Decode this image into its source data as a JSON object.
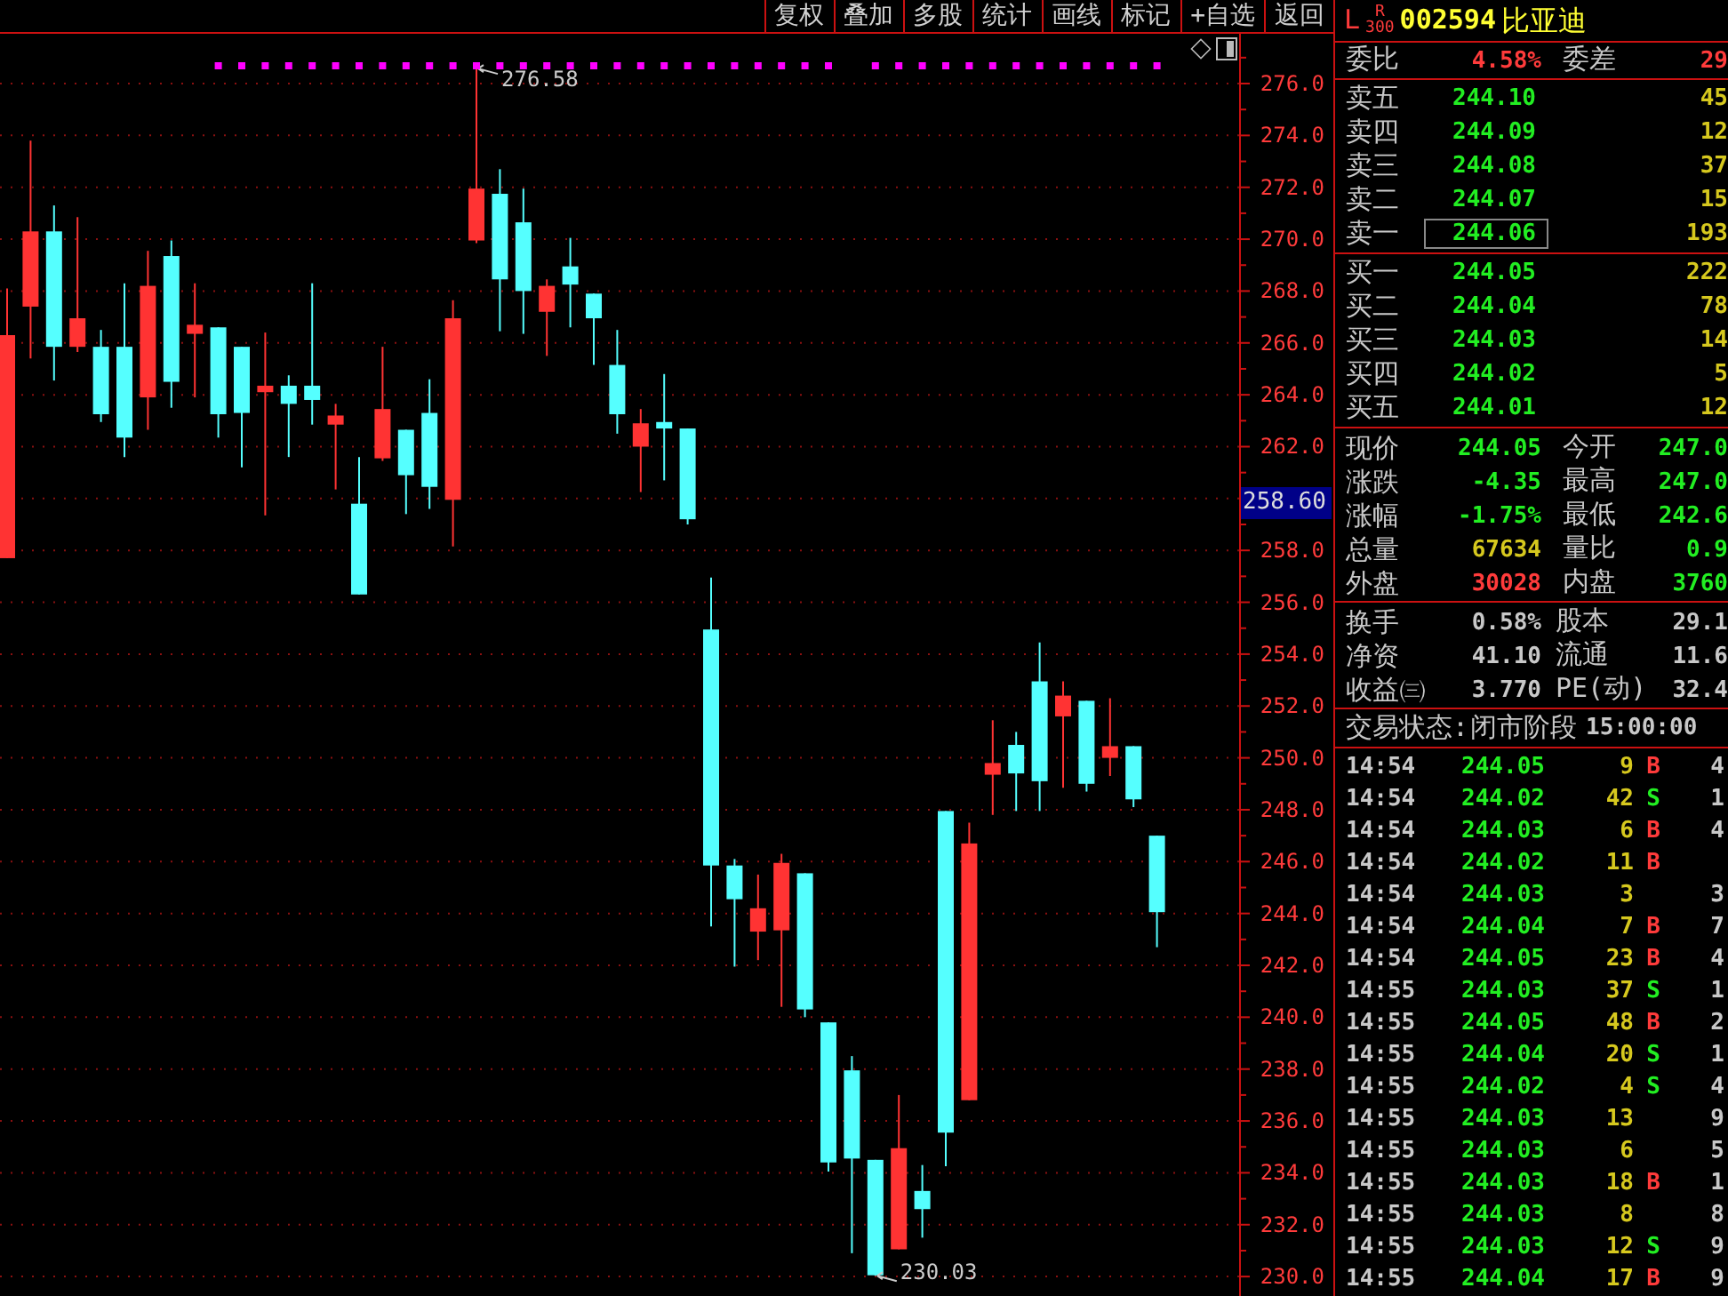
{
  "toolbar": [
    "复权",
    "叠加",
    "多股",
    "统计",
    "画线",
    "标记",
    "+自选",
    "返回"
  ],
  "chart": {
    "cursor_price": "258.60",
    "chart_data": {
      "type": "candlestick",
      "ylim": [
        229.25,
        277.92
      ],
      "grid": true,
      "yticks": [
        {
          "value": 276,
          "label": "276.0"
        },
        {
          "value": 274,
          "label": "274.0"
        },
        {
          "value": 272,
          "label": "272.0"
        },
        {
          "value": 270,
          "label": "270.0"
        },
        {
          "value": 268,
          "label": "268.0"
        },
        {
          "value": 266,
          "label": "266.0"
        },
        {
          "value": 264,
          "label": "264.0"
        },
        {
          "value": 262,
          "label": "262.0"
        },
        {
          "value": 258,
          "label": "258.0"
        },
        {
          "value": 256,
          "label": "256.0"
        },
        {
          "value": 254,
          "label": "254.0"
        },
        {
          "value": 252,
          "label": "252.0"
        },
        {
          "value": 250,
          "label": "250.0"
        },
        {
          "value": 248,
          "label": "248.0"
        },
        {
          "value": 246,
          "label": "246.0"
        },
        {
          "value": 244,
          "label": "244.0"
        },
        {
          "value": 242,
          "label": "242.0"
        },
        {
          "value": 240,
          "label": "240.0"
        },
        {
          "value": 238,
          "label": "238.0"
        },
        {
          "value": 236,
          "label": "236.0"
        },
        {
          "value": 234,
          "label": "234.0"
        },
        {
          "value": 232,
          "label": "232.0"
        },
        {
          "value": 230,
          "label": "230.0"
        }
      ],
      "ohlc": [
        [
          257.7,
          268.1,
          257.7,
          266.3
        ],
        [
          267.4,
          273.8,
          265.4,
          270.3
        ],
        [
          270.3,
          271.3,
          264.55,
          265.85
        ],
        [
          265.85,
          270.85,
          265.65,
          266.95
        ],
        [
          265.85,
          266.5,
          262.95,
          263.25
        ],
        [
          265.85,
          268.3,
          261.6,
          262.35
        ],
        [
          263.9,
          269.55,
          262.65,
          268.2
        ],
        [
          269.35,
          269.95,
          263.5,
          264.5
        ],
        [
          266.35,
          268.3,
          263.9,
          266.7
        ],
        [
          266.6,
          266.6,
          262.35,
          263.25
        ],
        [
          265.85,
          265.85,
          261.2,
          263.3
        ],
        [
          264.1,
          266.4,
          259.35,
          264.35
        ],
        [
          264.35,
          264.75,
          261.6,
          263.65
        ],
        [
          264.35,
          268.3,
          262.85,
          263.8
        ],
        [
          262.85,
          263.65,
          260.35,
          263.2
        ],
        [
          259.8,
          261.6,
          256.3,
          256.3
        ],
        [
          261.55,
          265.85,
          261.45,
          263.45
        ],
        [
          262.65,
          262.65,
          259.4,
          260.9
        ],
        [
          263.3,
          264.6,
          259.6,
          260.45
        ],
        [
          259.95,
          267.65,
          258.15,
          266.95
        ],
        [
          269.95,
          276.58,
          269.85,
          271.95
        ],
        [
          271.75,
          272.7,
          266.45,
          268.45
        ],
        [
          270.65,
          271.95,
          266.35,
          268.0
        ],
        [
          267.2,
          268.45,
          265.5,
          268.2
        ],
        [
          268.95,
          270.05,
          266.6,
          268.25
        ],
        [
          267.9,
          267.9,
          265.15,
          266.95
        ],
        [
          265.15,
          266.5,
          262.5,
          263.25
        ],
        [
          262.0,
          263.45,
          260.25,
          262.9
        ],
        [
          262.95,
          264.8,
          260.7,
          262.7
        ],
        [
          262.7,
          262.7,
          259.0,
          259.2
        ],
        [
          254.95,
          256.95,
          243.5,
          245.85
        ],
        [
          245.85,
          246.1,
          241.95,
          244.55
        ],
        [
          243.3,
          245.5,
          242.2,
          244.2
        ],
        [
          243.35,
          246.3,
          240.4,
          245.95
        ],
        [
          245.55,
          245.55,
          240.0,
          240.3
        ],
        [
          239.8,
          239.8,
          234.05,
          234.4
        ],
        [
          237.95,
          238.5,
          230.9,
          234.55
        ],
        [
          234.5,
          234.5,
          230.03,
          230.05
        ],
        [
          231.05,
          237.0,
          231.05,
          234.95
        ],
        [
          233.3,
          234.3,
          231.5,
          232.6
        ],
        [
          247.95,
          247.95,
          234.25,
          235.55
        ],
        [
          236.8,
          247.5,
          236.8,
          246.7
        ],
        [
          249.35,
          251.45,
          247.8,
          249.8
        ],
        [
          250.5,
          251.0,
          247.95,
          249.4
        ],
        [
          252.95,
          254.45,
          247.95,
          249.1
        ],
        [
          251.6,
          252.95,
          248.85,
          252.4
        ],
        [
          252.2,
          252.2,
          248.7,
          249.0
        ],
        [
          250.0,
          252.3,
          249.3,
          250.45
        ],
        [
          250.45,
          250.45,
          248.1,
          248.4
        ],
        [
          247.0,
          247.0,
          242.7,
          244.05
        ]
      ],
      "annotations": [
        {
          "text": "276.58"
        },
        {
          "text": "230.03"
        }
      ]
    }
  },
  "stock": {
    "market": "L",
    "index_mark": "R",
    "index_code": "300",
    "code": "002594",
    "name": "比亚迪"
  },
  "order_summary": [
    {
      "label": "委比",
      "value": "4.58%"
    },
    {
      "label": "委差",
      "value": "29"
    }
  ],
  "asks": [
    {
      "label": "卖五",
      "price": "244.10",
      "volume": "45",
      "selected": false
    },
    {
      "label": "卖四",
      "price": "244.09",
      "volume": "12",
      "selected": false
    },
    {
      "label": "卖三",
      "price": "244.08",
      "volume": "37",
      "selected": false
    },
    {
      "label": "卖二",
      "price": "244.07",
      "volume": "15",
      "selected": false
    },
    {
      "label": "卖一",
      "price": "244.06",
      "volume": "193",
      "selected": true
    }
  ],
  "bids": [
    {
      "label": "买一",
      "price": "244.05",
      "volume": "222",
      "selected": false
    },
    {
      "label": "买二",
      "price": "244.04",
      "volume": "78",
      "selected": false
    },
    {
      "label": "买三",
      "price": "244.03",
      "volume": "14",
      "selected": false
    },
    {
      "label": "买四",
      "price": "244.02",
      "volume": "5",
      "selected": false
    },
    {
      "label": "买五",
      "price": "244.01",
      "volume": "12",
      "selected": false
    }
  ],
  "quote": [
    {
      "label": "现价",
      "value": "244.05",
      "color": "#22ee22",
      "label2": "今开",
      "value2": "247.0"
    },
    {
      "label": "涨跌",
      "value": "-4.35",
      "color": "#22ee22",
      "label2": "最高",
      "value2": "247.0"
    },
    {
      "label": "涨幅",
      "value": "-1.75%",
      "color": "#22ee22",
      "label2": "最低",
      "value2": "242.6"
    },
    {
      "label": "总量",
      "value": "67634",
      "color": "#d6c81e",
      "label2": "量比",
      "value2": "0.9"
    },
    {
      "label": "外盘",
      "value": "30028",
      "color": "#ff3b3b",
      "label2": "内盘",
      "value2": "3760"
    }
  ],
  "fundamentals": [
    {
      "label": "换手",
      "value": "0.58%",
      "label2": "股本",
      "value2": "29.1"
    },
    {
      "label": "净资",
      "value": "41.10",
      "label2": "流通",
      "value2": "11.6"
    },
    {
      "label": "收益㈢",
      "value": "3.770",
      "label2": "PE(动)",
      "value2": "32.4"
    }
  ],
  "trading_status": {
    "label": "交易状态:",
    "value": "闭市阶段",
    "time": "15:00:00"
  },
  "ticks": [
    {
      "time": "14:54",
      "price": "244.05",
      "volume": "9",
      "side": "B",
      "color": "#ff3b3b",
      "column_5": "4"
    },
    {
      "time": "14:54",
      "price": "244.02",
      "volume": "42",
      "side": "S",
      "color": "#22ee22",
      "column_5": "1"
    },
    {
      "time": "14:54",
      "price": "244.03",
      "volume": "6",
      "side": "B",
      "color": "#ff3b3b",
      "column_5": "4"
    },
    {
      "time": "14:54",
      "price": "244.02",
      "volume": "11",
      "side": "B",
      "color": "#ff3b3b"
    },
    {
      "time": "14:54",
      "price": "244.03",
      "volume": "3",
      "column_5": "3"
    },
    {
      "time": "14:54",
      "price": "244.04",
      "volume": "7",
      "side": "B",
      "color": "#ff3b3b",
      "column_5": "7"
    },
    {
      "time": "14:54",
      "price": "244.05",
      "volume": "23",
      "side": "B",
      "color": "#ff3b3b",
      "column_5": "4"
    },
    {
      "time": "14:55",
      "price": "244.03",
      "volume": "37",
      "side": "S",
      "color": "#22ee22",
      "column_5": "1"
    },
    {
      "time": "14:55",
      "price": "244.05",
      "volume": "48",
      "side": "B",
      "color": "#ff3b3b",
      "column_5": "2"
    },
    {
      "time": "14:55",
      "price": "244.04",
      "volume": "20",
      "side": "S",
      "color": "#22ee22",
      "column_5": "1"
    },
    {
      "time": "14:55",
      "price": "244.02",
      "volume": "4",
      "side": "S",
      "color": "#22ee22",
      "column_5": "4"
    },
    {
      "time": "14:55",
      "price": "244.03",
      "volume": "13",
      "column_5": "9"
    },
    {
      "time": "14:55",
      "price": "244.03",
      "volume": "6",
      "column_5": "5"
    },
    {
      "time": "14:55",
      "price": "244.03",
      "volume": "18",
      "side": "B",
      "color": "#ff3b3b",
      "column_5": "1"
    },
    {
      "time": "14:55",
      "price": "244.03",
      "volume": "8",
      "column_5": "8"
    },
    {
      "time": "14:55",
      "price": "244.03",
      "volume": "12",
      "side": "S",
      "color": "#22ee22",
      "column_5": "9"
    },
    {
      "time": "14:55",
      "price": "244.04",
      "volume": "17",
      "side": "B",
      "color": "#ff3b3b",
      "column_5": "9"
    }
  ]
}
